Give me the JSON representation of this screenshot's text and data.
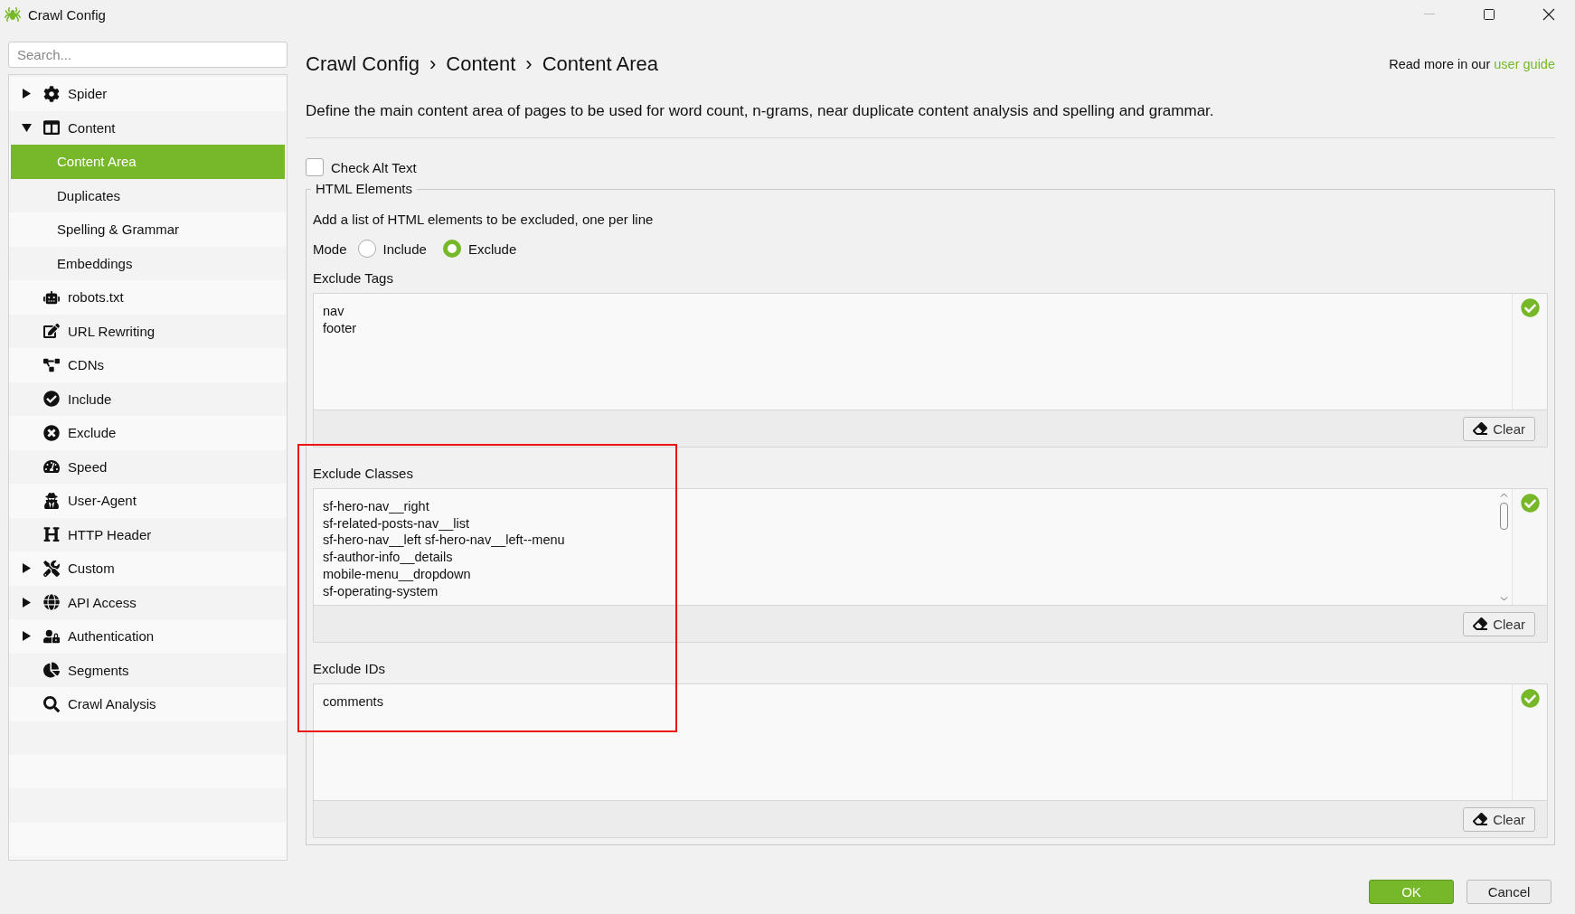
{
  "window": {
    "title": "Crawl Config"
  },
  "sidebar": {
    "search": {
      "placeholder": "Search..."
    },
    "items": [
      {
        "label": "Spider",
        "expanded": false,
        "selected": false
      },
      {
        "label": "Content",
        "expanded": true,
        "selected": false,
        "children": [
          {
            "label": "Content Area",
            "selected": true
          },
          {
            "label": "Duplicates",
            "selected": false
          },
          {
            "label": "Spelling & Grammar",
            "selected": false
          },
          {
            "label": "Embeddings",
            "selected": false
          }
        ]
      },
      {
        "label": "robots.txt",
        "selected": false
      },
      {
        "label": "URL Rewriting",
        "selected": false
      },
      {
        "label": "CDNs",
        "selected": false
      },
      {
        "label": "Include",
        "selected": false
      },
      {
        "label": "Exclude",
        "selected": false
      },
      {
        "label": "Speed",
        "selected": false
      },
      {
        "label": "User-Agent",
        "selected": false
      },
      {
        "label": "HTTP Header",
        "selected": false
      },
      {
        "label": "Custom",
        "expanded": false,
        "selected": false
      },
      {
        "label": "API Access",
        "expanded": false,
        "selected": false
      },
      {
        "label": "Authentication",
        "expanded": false,
        "selected": false
      },
      {
        "label": "Segments",
        "selected": false
      },
      {
        "label": "Crawl Analysis",
        "selected": false
      }
    ]
  },
  "header": {
    "breadcrumb": [
      "Crawl Config",
      "Content",
      "Content Area"
    ],
    "separator": "›",
    "help_text": "Read more in our",
    "help_link": "user guide"
  },
  "description": "Define the main content area of pages to be used for word count, n-grams, near duplicate content analysis and spelling and grammar.",
  "check_alt_text": {
    "label": "Check Alt Text",
    "checked": false
  },
  "group": {
    "title": "HTML Elements",
    "hint": "Add a list of HTML elements to be excluded, one per line",
    "mode": {
      "label": "Mode",
      "options": [
        {
          "label": "Include",
          "selected": false
        },
        {
          "label": "Exclude",
          "selected": true
        }
      ]
    },
    "lists": [
      {
        "label": "Exclude Tags",
        "lines": [
          "nav",
          "footer"
        ],
        "valid": true,
        "scrollable": false,
        "button": "Clear"
      },
      {
        "label": "Exclude Classes",
        "lines": [
          "sf-hero-nav__right",
          "sf-related-posts-nav__list",
          "sf-hero-nav__left sf-hero-nav__left--menu",
          "sf-author-info__details",
          "mobile-menu__dropdown",
          "sf-operating-system"
        ],
        "valid": true,
        "scrollable": true,
        "button": "Clear"
      },
      {
        "label": "Exclude IDs",
        "lines": [
          "comments"
        ],
        "valid": true,
        "scrollable": false,
        "button": "Clear"
      }
    ]
  },
  "buttons": [
    {
      "label": "OK",
      "kind": "primary"
    },
    {
      "label": "Cancel",
      "kind": "secondary"
    }
  ]
}
